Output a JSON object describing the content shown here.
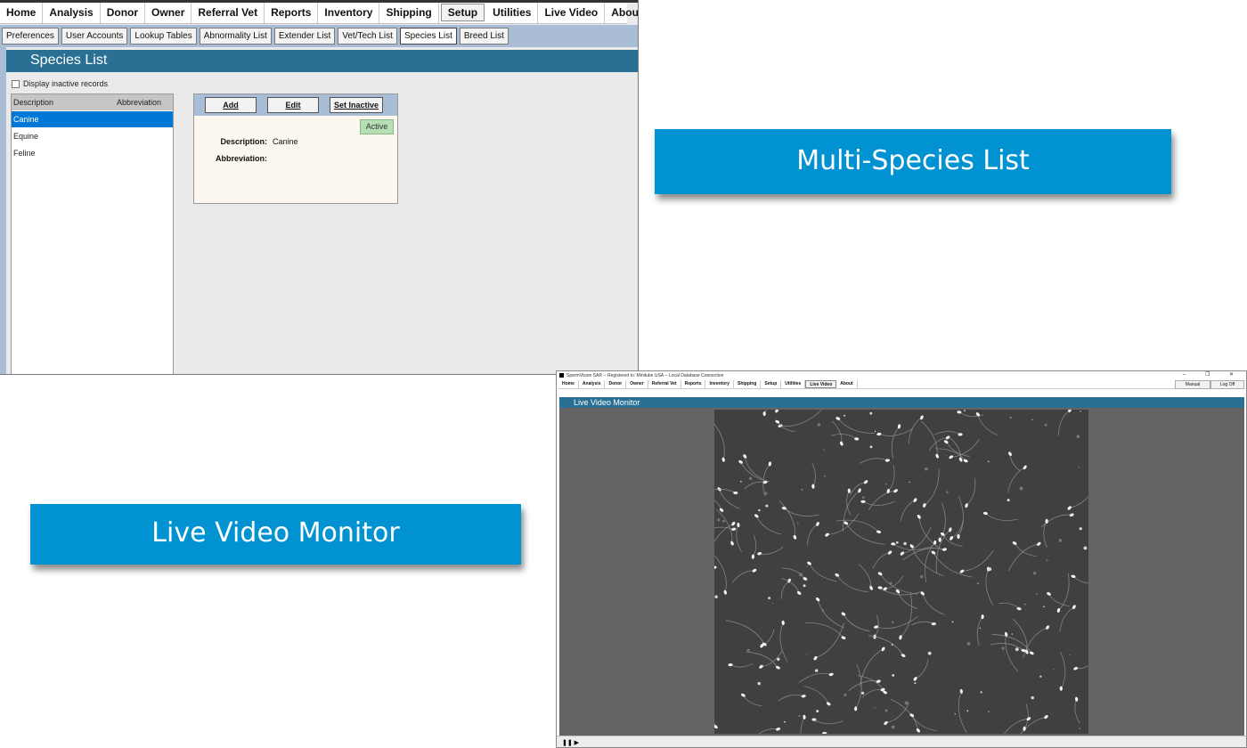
{
  "species_window": {
    "main_menu": [
      "Home",
      "Analysis",
      "Donor",
      "Owner",
      "Referral Vet",
      "Reports",
      "Inventory",
      "Shipping",
      "Setup",
      "Utilities",
      "Live Video",
      "About"
    ],
    "active_main": "Setup",
    "sub_menu": [
      "Preferences",
      "User Accounts",
      "Lookup Tables",
      "Abnormality List",
      "Extender List",
      "Vet/Tech List",
      "Species List",
      "Breed List"
    ],
    "active_sub": "Species List",
    "page_title": "Species List",
    "inactive_checkbox_label": "Display inactive records",
    "inactive_checked": false,
    "list_columns": [
      "Description",
      "Abbreviation"
    ],
    "list_rows": [
      "Canine",
      "Equine",
      "Feline"
    ],
    "selected_row": "Canine",
    "buttons": {
      "add": "Add",
      "edit": "Edit",
      "set_inactive": "Set Inactive"
    },
    "status_badge": "Active",
    "detail": {
      "description_label": "Description:",
      "description_value": "Canine",
      "abbreviation_label": "Abbreviation:",
      "abbreviation_value": ""
    }
  },
  "callouts": {
    "species": "Multi-Species List",
    "video": "Live Video Monitor"
  },
  "video_window": {
    "title": "SpermVision SAR -- Registered to: Minitube USA -- Local Database Connection",
    "window_controls": "– ❐ ✕",
    "main_menu": [
      "Home",
      "Analysis",
      "Donor",
      "Owner",
      "Referral Vet",
      "Reports",
      "Inventory",
      "Shipping",
      "Setup",
      "Utilities",
      "Live Video",
      "About"
    ],
    "active_main": "Live Video",
    "manual_button": "Manual",
    "logoff_button": "Log Off",
    "page_title": "Live Video Monitor",
    "play_control": "❚❚ ▶"
  },
  "colors": {
    "header_blue": "#2a6f94",
    "callout_blue": "#0092d1",
    "selection_blue": "#0078d7",
    "active_green": "#b7dfb6"
  }
}
